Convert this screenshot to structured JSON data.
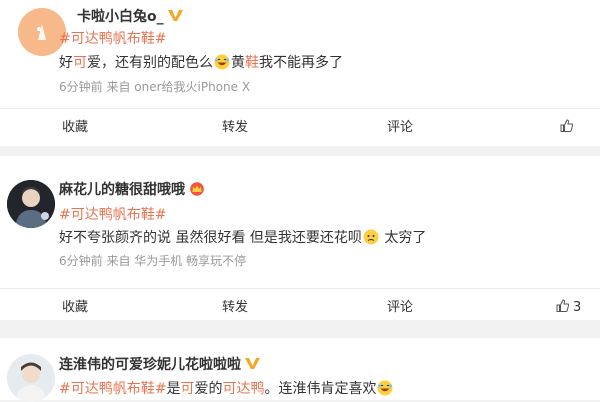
{
  "posts": [
    {
      "user_name": "卡啦小白兔o_",
      "badge": "vip-icon",
      "tag": "#可达鸭帆布鞋#",
      "content": {
        "p1": "好",
        "h1": "可",
        "p2": "爱，还有别的配色么",
        "emoji": "grin-emoji",
        "p3": "黄",
        "h2": "鞋",
        "p4": "我不能再多了"
      },
      "meta": "6分钟前  来自 oner给我火iPhone X",
      "actions": {
        "collect": "收藏",
        "repost": "转发",
        "comment": "评论",
        "like_count": ""
      }
    },
    {
      "user_name": "麻花儿的糖很甜哦哦",
      "badge": "crown-icon",
      "tag": "#可达鸭帆布鞋#",
      "content": {
        "p1": "好不夸张颜齐的说 虽然很好看 但是我还要还花呗",
        "emoji": "sad-emoji",
        "p2": " 太穷了"
      },
      "meta": "6分钟前  来自 华为手机 畅享玩不停",
      "actions": {
        "collect": "收藏",
        "repost": "转发",
        "comment": "评论",
        "like_count": "3"
      }
    },
    {
      "user_name": "连淮伟的可爱珍妮儿花啦啦啦",
      "badge": "vip-icon",
      "content": {
        "h1": "#可达鸭帆布鞋#",
        "p1": "是",
        "h2": "可",
        "p2": "爱的",
        "h3": "可达鸭",
        "p3": "。连淮伟肯定喜欢",
        "emoji": "grin-emoji"
      }
    }
  ],
  "colors": {
    "accent": "#eb7350",
    "vip": "#f6a623"
  }
}
